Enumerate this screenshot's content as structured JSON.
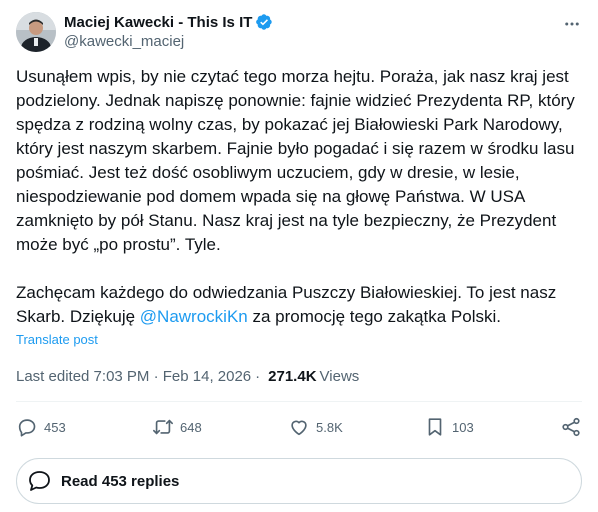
{
  "author": {
    "display_name": "Maciej Kawecki - This Is IT",
    "handle": "@kawecki_maciej",
    "verified": true
  },
  "post": {
    "paragraphs": [
      "Usunąłem wpis, by nie czytać tego morza hejtu. Poraża, jak nasz kraj jest podzielony. Jednak napiszę ponownie: fajnie widzieć Prezydenta RP, który spędza z rodziną wolny czas, by pokazać jej Białowieski Park Narodowy, który jest naszym skarbem. Fajnie było pogadać i się razem w środku lasu pośmiać. Jest też dość osobliwym uczuciem, gdy w dresie, w lesie, niespodziewanie pod domem wpada się na głowę Państwa. W USA zamknięto by pół Stanu. Nasz kraj jest na tyle bezpieczny, że Prezydent może być „po prostu”. Tyle."
    ],
    "closing_before": "Zachęcam każdego do odwiedzania Puszczy Białowieskiej. To jest nasz Skarb. Dziękuję ",
    "mention": "@NawrockiKn",
    "closing_after": " za promocję tego zakątka Polski.",
    "translate_label": "Translate post"
  },
  "meta": {
    "edited": "Last edited 7:03 PM · Feb 14, 2026",
    "separator": "·",
    "views_count": "271.4K",
    "views_label": "Views"
  },
  "actions": {
    "replies": "453",
    "reposts": "648",
    "likes": "5.8K",
    "bookmarks": "103"
  },
  "read_replies_label": "Read 453 replies",
  "colors": {
    "accent": "#1d9bf0",
    "text": "#0f1419",
    "muted": "#536471",
    "border": "#cfd9de"
  },
  "icons": [
    "verified-badge-icon",
    "more-icon",
    "reply-icon",
    "repost-icon",
    "like-icon",
    "bookmark-icon",
    "share-icon",
    "replies-bubble-icon"
  ]
}
